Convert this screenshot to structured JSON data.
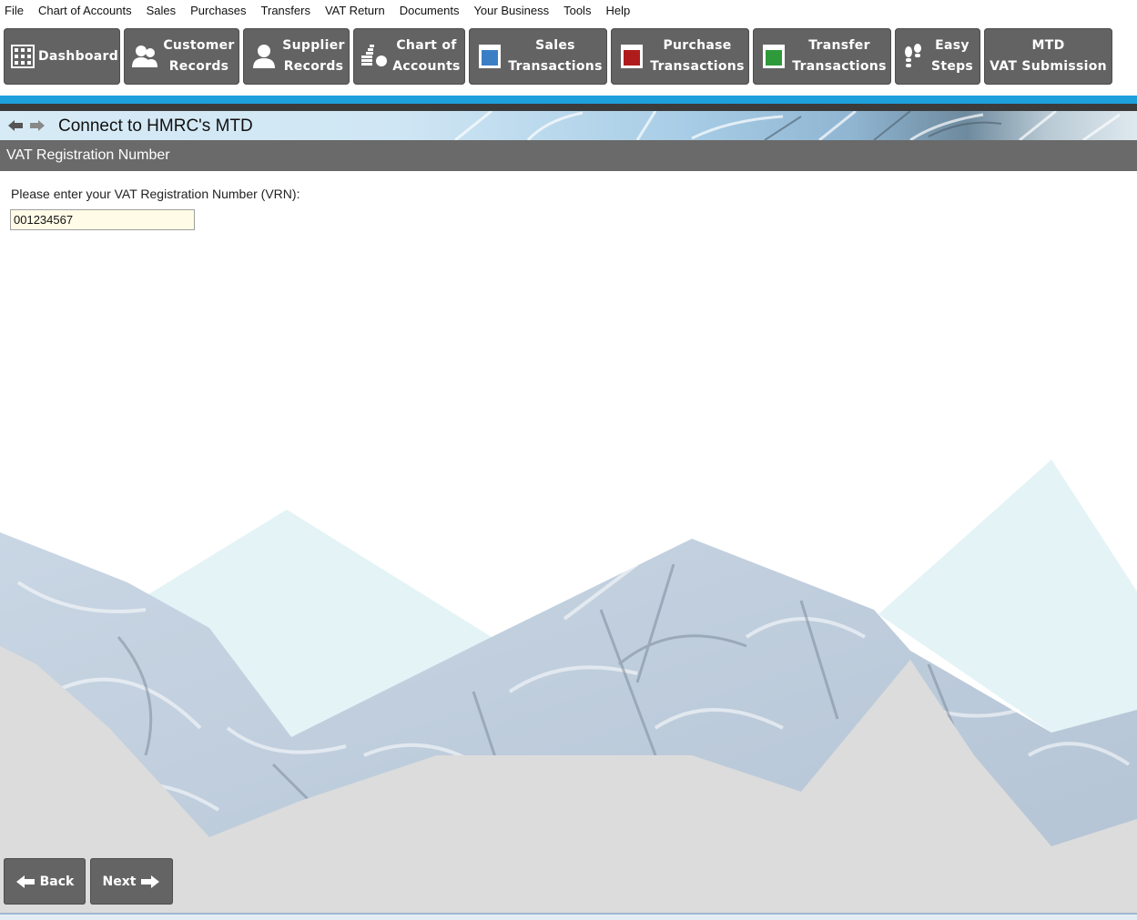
{
  "menu": [
    "File",
    "Chart of Accounts",
    "Sales",
    "Purchases",
    "Transfers",
    "VAT Return",
    "Documents",
    "Your Business",
    "Tools",
    "Help"
  ],
  "toolbar": {
    "dashboard": [
      "Dashboard"
    ],
    "customer": [
      "Customer",
      "Records"
    ],
    "supplier": [
      "Supplier",
      "Records"
    ],
    "chart": [
      "Chart of",
      "Accounts"
    ],
    "sales": [
      "Sales",
      "Transactions"
    ],
    "purchase": [
      "Purchase",
      "Transactions"
    ],
    "transfer": [
      "Transfer",
      "Transactions"
    ],
    "easy": [
      "Easy",
      "Steps"
    ],
    "mtd": [
      "MTD",
      "VAT Submission"
    ]
  },
  "colors": {
    "accent": "#1ea0dc",
    "button_bg": "#636363",
    "section_header": "#6a6a6a",
    "sales_icon": "#3a7fc6",
    "purchase_icon": "#b01c1c",
    "transfer_icon": "#2e9a3a"
  },
  "page": {
    "title": "Connect to HMRC's MTD",
    "section_header": "VAT Registration Number",
    "prompt": "Please enter your VAT Registration Number (VRN):",
    "vrn_value": "001234567"
  },
  "nav": {
    "back_label": "Back",
    "next_label": "Next"
  }
}
